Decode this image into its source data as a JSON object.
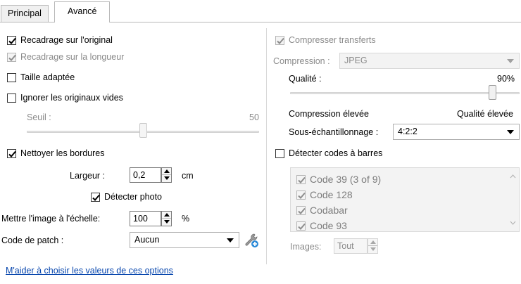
{
  "tabs": [
    {
      "label": "Principal"
    },
    {
      "label": "Avancé"
    }
  ],
  "left": {
    "crop_original": {
      "label": "Recadrage sur l'original",
      "checked": true
    },
    "crop_length": {
      "label": "Recadrage sur la longueur",
      "checked": true,
      "disabled": true
    },
    "fit_size": {
      "label": "Taille adaptée",
      "checked": false
    },
    "ignore_blank": {
      "label": "Ignorer les originaux vides",
      "checked": false
    },
    "threshold": {
      "label": "Seuil :",
      "value_text": "50",
      "value": 50
    },
    "clean_borders": {
      "label": "Nettoyer les bordures",
      "checked": true
    },
    "width": {
      "label": "Largeur :",
      "value": "0,2",
      "unit": "cm"
    },
    "detect_photo": {
      "label": "Détecter photo",
      "checked": true
    },
    "scale": {
      "label": "Mettre l'image à l'échelle:",
      "value": "100",
      "unit": "%"
    },
    "patch": {
      "label": "Code de patch :",
      "selected": "Aucun"
    }
  },
  "right": {
    "compress_transfers": {
      "label": "Compresser transferts",
      "checked": true,
      "disabled": true
    },
    "compression": {
      "label": "Compression :",
      "selected": "JPEG"
    },
    "quality": {
      "label": "Qualité :",
      "value_text": "90%",
      "value": 90
    },
    "quality_low": "Compression élevée",
    "quality_high": "Qualité élevée",
    "subsampling": {
      "label": "Sous-échantillonnage :",
      "selected": "4:2:2"
    },
    "detect_barcodes": {
      "label": "Détecter codes à barres",
      "checked": false
    },
    "barcodes": [
      {
        "label": "Code 39 (3 of 9)",
        "checked": true
      },
      {
        "label": "Code 128",
        "checked": true
      },
      {
        "label": "Codabar",
        "checked": true
      },
      {
        "label": "Code 93",
        "checked": true
      }
    ],
    "images": {
      "label": "Images:",
      "value": "Tout"
    }
  },
  "help_link": "M'aider à choisir les valeurs de ces options",
  "colors": {
    "link": "#0645ad",
    "disabled_text": "#8a8a8a"
  }
}
